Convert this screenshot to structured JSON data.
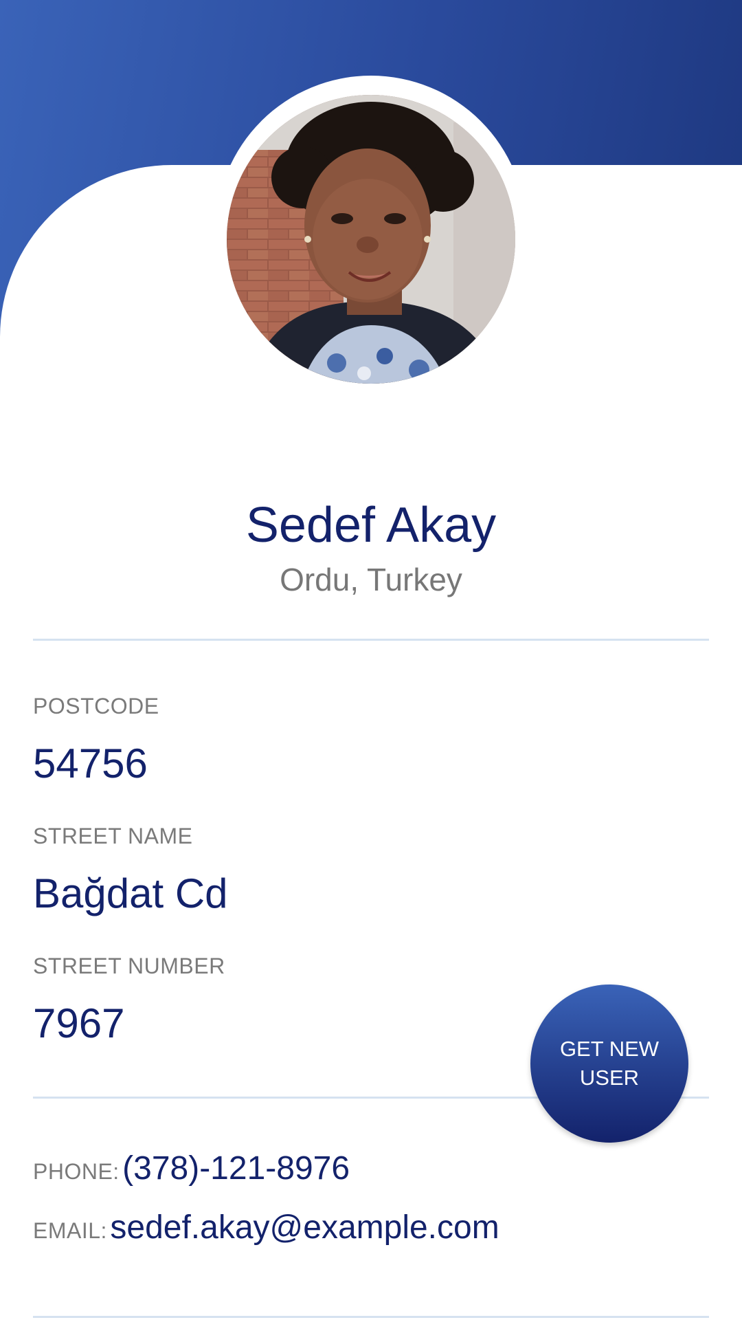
{
  "profile": {
    "name": "Sedef Akay",
    "location": "Ordu, Turkey"
  },
  "fields": [
    {
      "label": "POSTCODE",
      "value": "54756"
    },
    {
      "label": "STREET NAME",
      "value": "Bağdat Cd"
    },
    {
      "label": "STREET NUMBER",
      "value": "7967"
    }
  ],
  "contact": {
    "phone_label": "PHONE:",
    "phone": "(378)-121-8976",
    "email_label": "EMAIL:",
    "email": "sedef.akay@example.com"
  },
  "button": {
    "label": "GET NEW USER"
  },
  "colors": {
    "primary_dark": "#13226b",
    "primary": "#2a4a9c",
    "primary_light": "#3a63b8",
    "label_gray": "#7a7a7a",
    "divider": "#d5e2f0"
  }
}
